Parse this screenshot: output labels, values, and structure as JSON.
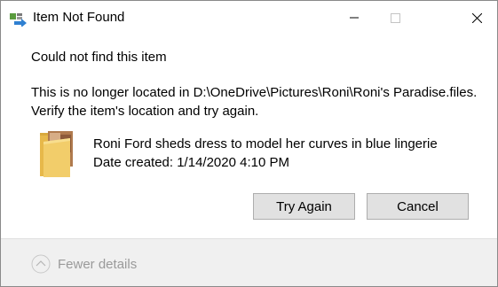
{
  "window": {
    "title": "Item Not Found",
    "controls": {
      "minimize": "minimize-icon",
      "maximize": "maximize-icon",
      "close": "close-icon"
    }
  },
  "message": {
    "headline": "Could not find this item",
    "detail_line1": "This is no longer located in D:\\OneDrive\\Pictures\\Roni\\Roni's Paradise.files.",
    "detail_line2": "Verify the item's location and try again."
  },
  "item": {
    "name": "Roni Ford sheds dress to model her curves in blue lingerie",
    "date_created": "Date created: 1/14/2020 4:10 PM",
    "icon": "folder-icon"
  },
  "buttons": {
    "try_again": "Try Again",
    "cancel": "Cancel"
  },
  "footer": {
    "details_toggle": "Fewer details",
    "details_icon": "chevron-up-icon"
  },
  "colors": {
    "button_bg": "#e1e1e1",
    "button_border": "#adadad",
    "footer_bg": "#f0f0f0",
    "muted_text": "#9a9a9a"
  }
}
